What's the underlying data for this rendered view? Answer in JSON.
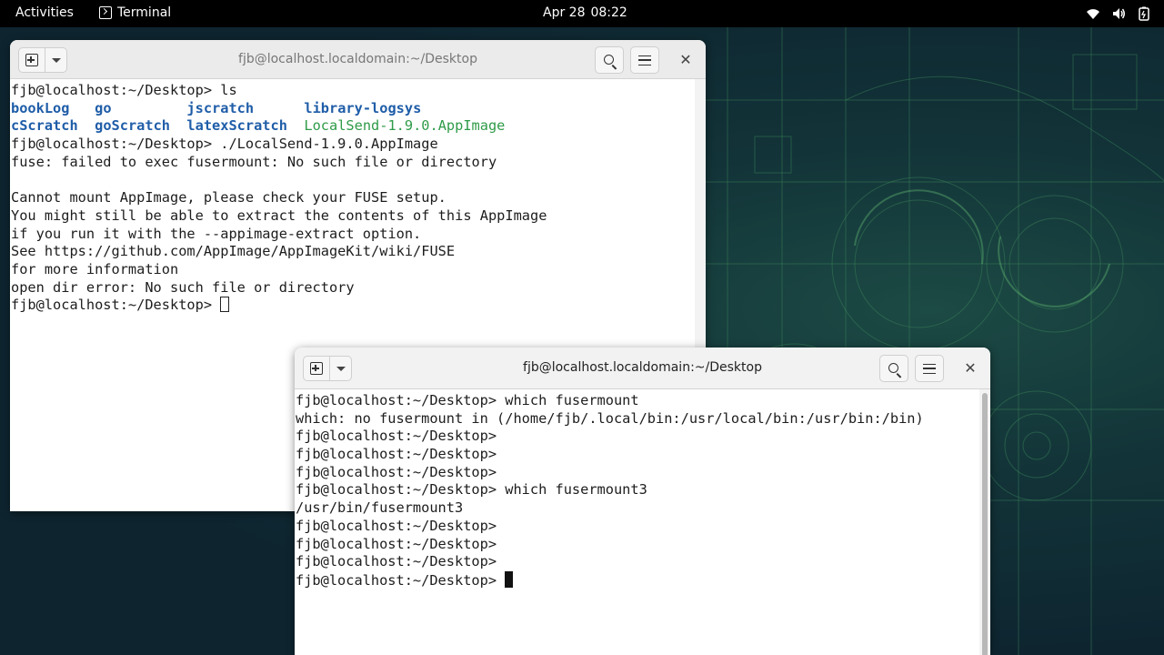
{
  "topbar": {
    "activities": "Activities",
    "app_name": "Terminal",
    "date": "Apr 28",
    "time": "08:22",
    "tray_icons": [
      "wifi-icon",
      "volume-icon",
      "battery-icon"
    ]
  },
  "terminal_back": {
    "title": "fjb@localhost.localdomain:~/Desktop",
    "lines": [
      "fjb@localhost:~/Desktop> ls",
      "",
      "",
      "fjb@localhost:~/Desktop> ./LocalSend-1.9.0.AppImage",
      "fuse: failed to exec fusermount: No such file or directory",
      "",
      "Cannot mount AppImage, please check your FUSE setup.",
      "You might still be able to extract the contents of this AppImage",
      "if you run it with the --appimage-extract option.",
      "See https://github.com/AppImage/AppImageKit/wiki/FUSE",
      "for more information",
      "open dir error: No such file or directory",
      "fjb@localhost:~/Desktop> "
    ],
    "ls_row1": [
      "bookLog",
      "go",
      "jscratch",
      "library-logsys"
    ],
    "ls_row2": [
      "cScratch",
      "goScratch",
      "latexScratch",
      "LocalSend-1.9.0.AppImage"
    ]
  },
  "terminal_front": {
    "title": "fjb@localhost.localdomain:~/Desktop",
    "lines": [
      "fjb@localhost:~/Desktop> which fusermount",
      "which: no fusermount in (/home/fjb/.local/bin:/usr/local/bin:/usr/bin:/bin)",
      "fjb@localhost:~/Desktop> ",
      "fjb@localhost:~/Desktop> ",
      "fjb@localhost:~/Desktop> ",
      "fjb@localhost:~/Desktop> which fusermount3",
      "/usr/bin/fusermount3",
      "fjb@localhost:~/Desktop> ",
      "fjb@localhost:~/Desktop> ",
      "fjb@localhost:~/Desktop> ",
      "fjb@localhost:~/Desktop> "
    ]
  },
  "colors": {
    "directory": "#1f5da8",
    "executable": "#2f9b48",
    "topbar": "#000000"
  }
}
